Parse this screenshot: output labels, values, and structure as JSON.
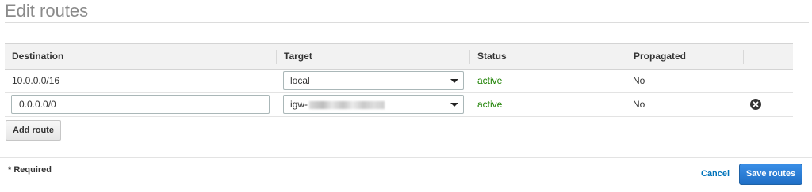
{
  "page": {
    "title": "Edit routes"
  },
  "table": {
    "columns": [
      "Destination",
      "Target",
      "Status",
      "Propagated"
    ],
    "rows": [
      {
        "destination": "10.0.0.0/16",
        "target": "local",
        "status": "active",
        "propagated": "No",
        "destination_editable": false,
        "removable": false
      },
      {
        "destination": "0.0.0.0/0",
        "target": "igw-",
        "status": "active",
        "propagated": "No",
        "destination_editable": true,
        "removable": true
      }
    ]
  },
  "actions": {
    "add_route": "Add route",
    "cancel": "Cancel",
    "save": "Save routes"
  },
  "footer": {
    "required_note": "* Required"
  },
  "colors": {
    "status_active": "#1d8102",
    "primary_button": "#2b7fd8",
    "link": "#0073bb"
  },
  "icons": {
    "dropdown": "caret-down-icon",
    "remove": "remove-circle-icon"
  }
}
